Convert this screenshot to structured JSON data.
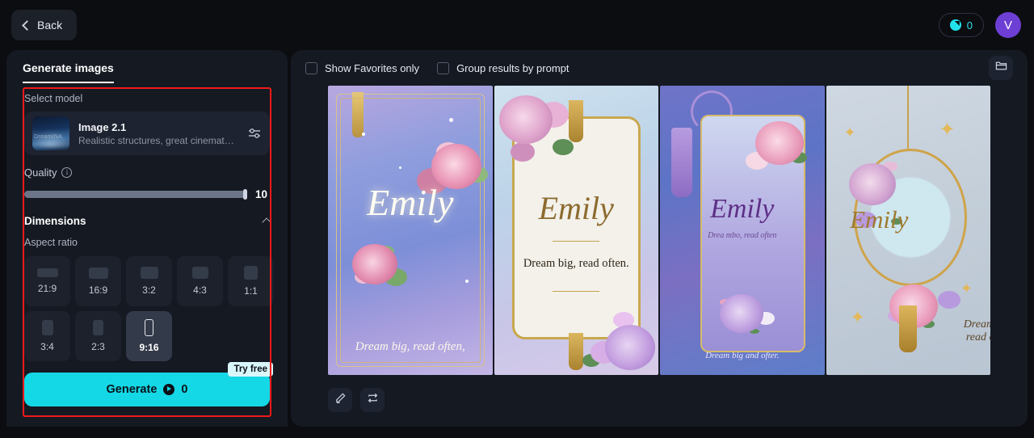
{
  "topbar": {
    "back_label": "Back",
    "credits_value": "0",
    "avatar_initial": "V"
  },
  "left_panel": {
    "tab_label": "Generate images",
    "select_model_label": "Select model",
    "model": {
      "name": "Image 2.1",
      "description": "Realistic structures, great cinematog...",
      "thumb_text": "DreamINA",
      "settings_icon": "sliders-icon"
    },
    "quality": {
      "label": "Quality",
      "info_icon": "info-icon",
      "value": "10",
      "percent": 100
    },
    "dimensions": {
      "title": "Dimensions",
      "collapse_icon": "chevron-up-icon",
      "aspect_ratio_label": "Aspect ratio",
      "options": [
        {
          "label": "21:9",
          "w": 26,
          "h": 11,
          "selected": false
        },
        {
          "label": "16:9",
          "w": 24,
          "h": 14,
          "selected": false
        },
        {
          "label": "3:2",
          "w": 22,
          "h": 15,
          "selected": false
        },
        {
          "label": "4:3",
          "w": 20,
          "h": 15,
          "selected": false
        },
        {
          "label": "1:1",
          "w": 17,
          "h": 17,
          "selected": false
        },
        {
          "label": "3:4",
          "w": 14,
          "h": 19,
          "selected": false
        },
        {
          "label": "2:3",
          "w": 13,
          "h": 19,
          "selected": false
        },
        {
          "label": "9:16",
          "w": 11,
          "h": 21,
          "selected": true
        }
      ]
    },
    "generate": {
      "label": "Generate",
      "cost": "0",
      "badge": "Try free"
    }
  },
  "right_panel": {
    "favorites_checkbox": {
      "label": "Show Favorites only",
      "checked": false
    },
    "group_checkbox": {
      "label": "Group results by prompt",
      "checked": false
    },
    "folder_icon": "folder-icon",
    "results": [
      {
        "name": "Emily",
        "tagline": "Dream big, read often,"
      },
      {
        "name": "Emily",
        "tagline": "Dream big, read often."
      },
      {
        "name": "Emily",
        "tagline": "Drea mbo, read often",
        "tagline2": "Dream big and ofter."
      },
      {
        "name": "Emily",
        "tagline": "Dream big,\nread often."
      }
    ],
    "tools": [
      {
        "icon": "pencil-icon",
        "name": "edit-button"
      },
      {
        "icon": "repeat-icon",
        "name": "regenerate-button"
      }
    ]
  },
  "colors": {
    "accent": "#15d8e6",
    "highlight_box": "#f11a1a",
    "avatar": "#6d3fd4",
    "panel": "#151922",
    "background": "#0c0d11"
  }
}
